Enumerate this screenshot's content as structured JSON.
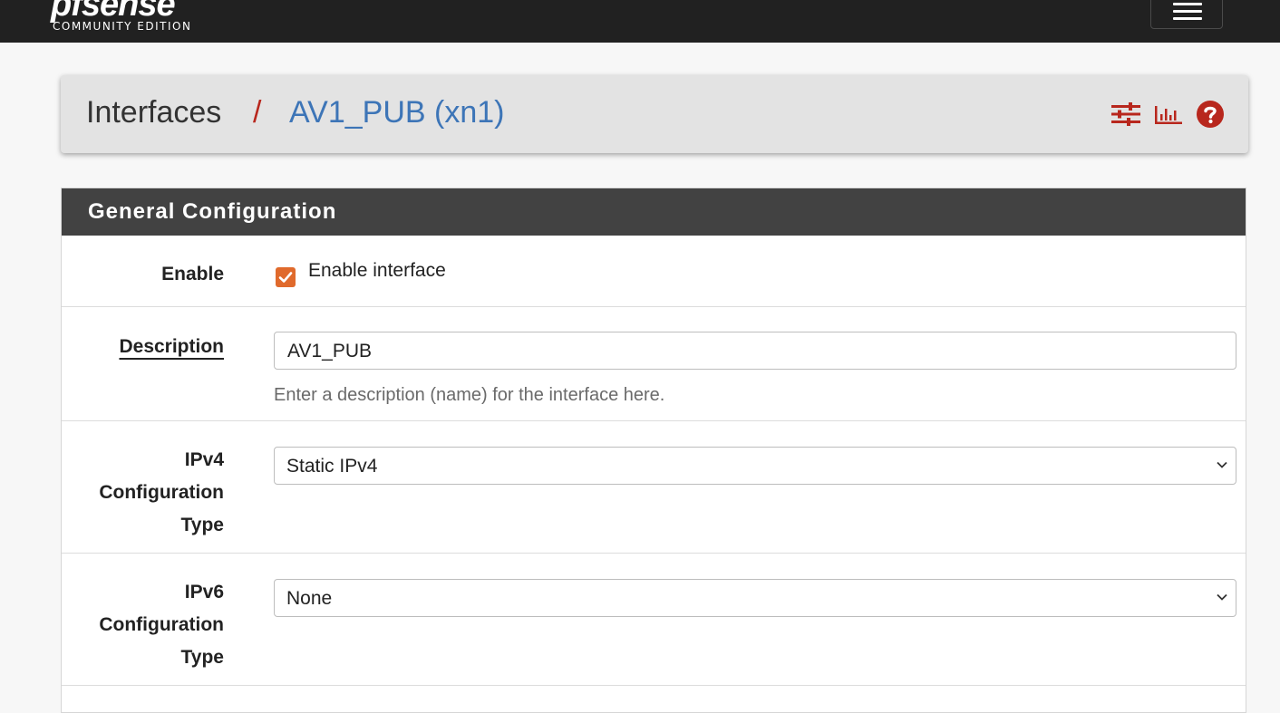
{
  "header": {
    "brand_logo": "pfsense",
    "brand_edition": "COMMUNITY EDITION",
    "menu_icon": "hamburger-menu-icon"
  },
  "breadcrumb": {
    "root": "Interfaces",
    "separator": "/",
    "current": "AV1_PUB (xn1)",
    "icons": [
      "sliders-icon",
      "bar-chart-icon",
      "help-icon"
    ],
    "icon_color": "#b8271d"
  },
  "panel": {
    "title": "General Configuration",
    "rows": {
      "enable": {
        "label": "Enable",
        "checkbox_label": "Enable interface",
        "checked": true
      },
      "description": {
        "label": "Description",
        "value": "AV1_PUB",
        "help": "Enter a description (name) for the interface here."
      },
      "ipv4_type": {
        "label_line1": "IPv4",
        "label_line2": "Configuration",
        "label_line3": "Type",
        "value": "Static IPv4"
      },
      "ipv6_type": {
        "label_line1": "IPv6",
        "label_line2": "Configuration",
        "label_line3": "Type",
        "value": "None"
      }
    }
  },
  "colors": {
    "topbar": "#212121",
    "panel_heading": "#424242",
    "accent_link": "#3d75b7",
    "accent_red": "#b8271d",
    "checkbox": "#e06a2c"
  }
}
